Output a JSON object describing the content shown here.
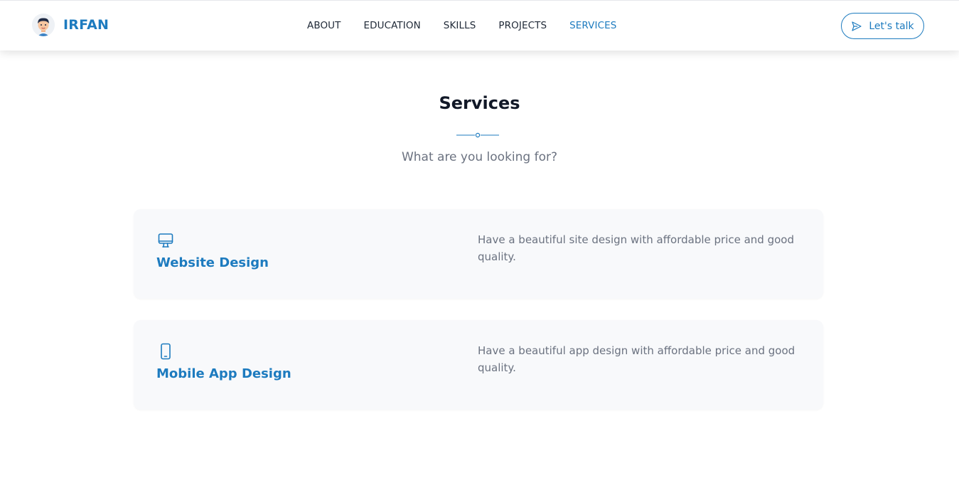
{
  "header": {
    "brand": "IRFAN",
    "avatar_icon": "boy-avatar-icon",
    "nav": [
      {
        "label": "ABOUT",
        "active": false
      },
      {
        "label": "EDUCATION",
        "active": false
      },
      {
        "label": "SKILLS",
        "active": false
      },
      {
        "label": "PROJECTS",
        "active": false
      },
      {
        "label": "SERVICES",
        "active": true
      }
    ],
    "cta": {
      "label": "Let's talk",
      "icon": "send-icon"
    }
  },
  "services": {
    "title": "Services",
    "subtitle": "What are you looking for?",
    "items": [
      {
        "icon": "monitor-icon",
        "title": "Website Design",
        "description": "Have a beautiful site design with affordable price and good quality."
      },
      {
        "icon": "smartphone-icon",
        "title": "Mobile App Design",
        "description": "Have a beautiful app design with affordable price and good quality."
      }
    ]
  },
  "colors": {
    "accent": "#1d7bbf",
    "text_dark": "#111827",
    "text_muted": "#6b7280",
    "card_bg": "#f8f9fb"
  }
}
